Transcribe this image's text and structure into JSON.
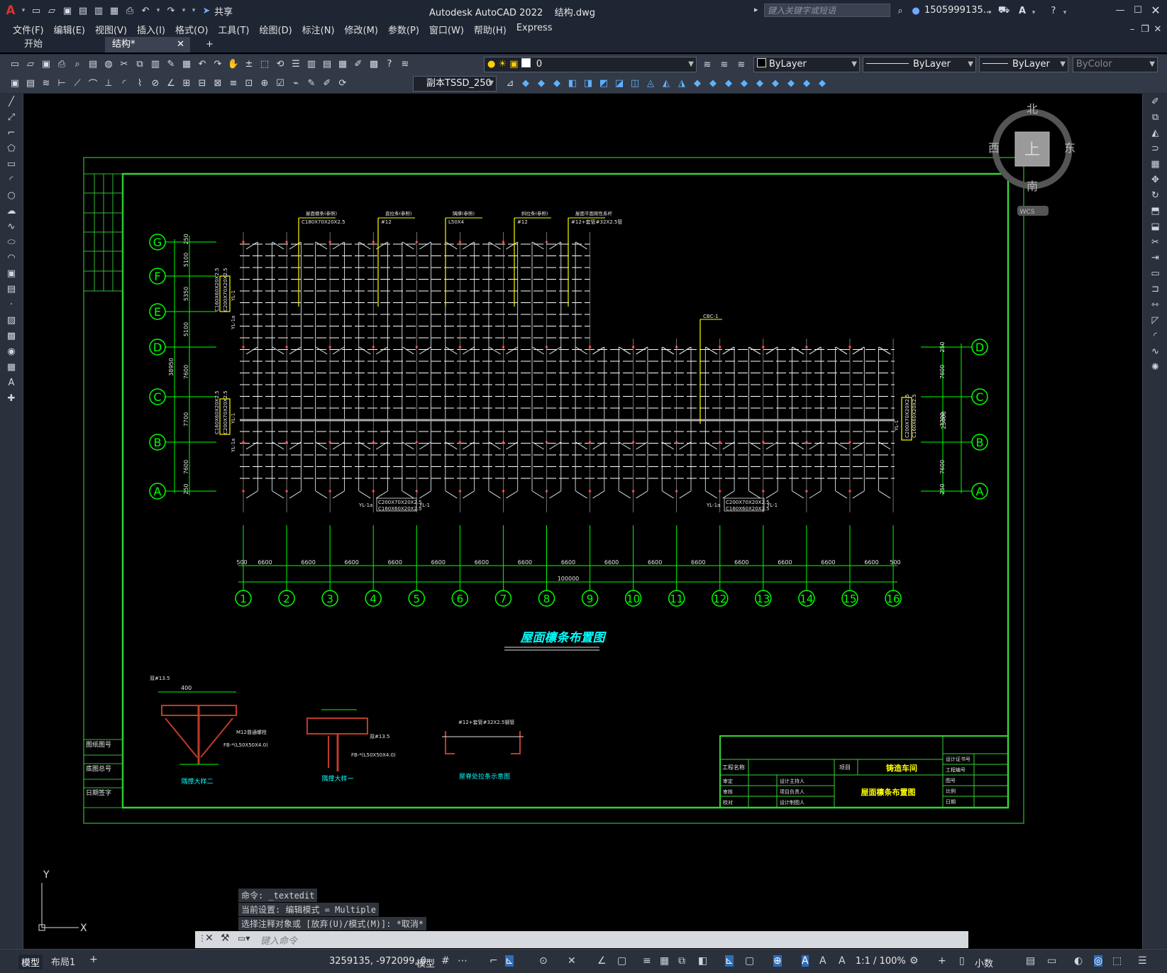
{
  "app": {
    "title": "Autodesk AutoCAD 2022",
    "file": "结构.dwg",
    "search_placeholder": "键入关键字或短语",
    "user": "1505999135...",
    "share": "共享"
  },
  "menu": [
    "文件(F)",
    "编辑(E)",
    "视图(V)",
    "插入(I)",
    "格式(O)",
    "工具(T)",
    "绘图(D)",
    "标注(N)",
    "修改(M)",
    "参数(P)",
    "窗口(W)",
    "帮助(H)",
    "Express"
  ],
  "tabs": {
    "start": "开始",
    "active": "结构*",
    "add": "+"
  },
  "toolbar": {
    "layer_value": "0",
    "color_value": "ByLayer",
    "linetype_value": "ByLayer",
    "lineweight_value": "ByLayer",
    "plotstyle_value": "ByColor",
    "textstyle_value": "副本TSSD_250"
  },
  "viewcube": {
    "north": "北",
    "south": "南",
    "east": "东",
    "west": "西",
    "top": "上",
    "wcs": "WCS"
  },
  "drawing": {
    "title": "屋面檩条布置图",
    "grid_rows": [
      "G",
      "F",
      "E",
      "D",
      "C",
      "B",
      "A"
    ],
    "grid_cols": [
      "1",
      "2",
      "3",
      "4",
      "5",
      "6",
      "7",
      "8",
      "9",
      "10",
      "11",
      "12",
      "13",
      "14",
      "15",
      "16"
    ],
    "bay_label": "6600",
    "edge_label": "500",
    "total_label": "100000",
    "left_dims": [
      "250",
      "5100",
      "5350",
      "5100",
      "7600",
      "7700",
      "7600",
      "250"
    ],
    "left_total": "38950",
    "right_dims": [
      "250",
      "7600",
      "7700",
      "7600",
      "250"
    ],
    "right_total": "23400",
    "top_callouts": [
      {
        "head": "屋面檩条(参照)",
        "sub": "C180X70X20X2.5"
      },
      {
        "head": "直拉条(参照)",
        "sub": "#12"
      },
      {
        "head": "隅撑(参照)",
        "sub": "L50X4"
      },
      {
        "head": "斜拉条(参照)",
        "sub": "#12"
      },
      {
        "head": "屋面平面刚性系杆",
        "sub": "#12+套管#32X2.5管"
      }
    ],
    "cbc_label": "CBC-1",
    "yl": [
      "YL-1",
      "YL-1a"
    ],
    "purlin_left": [
      "C160X60X20X2.5",
      "C200X70X20X2.5"
    ],
    "bottom_purlin": [
      "C200X70X20X2.5",
      "C160X60X20X2.5"
    ],
    "detail_captions": [
      "隅撑大样二",
      "隅撑大样一",
      "屋脊处拉条示意图"
    ],
    "detail_texts": [
      "双#13.5",
      "400",
      "M12普通螺栓",
      "FB-*(L50X50X4.0)",
      "#12+套管#32X2.5钢管"
    ],
    "title_block": {
      "project_label": "工程名称",
      "item_label": "项目",
      "project_name": "铸造车间",
      "drawing_name": "屋面檩条布置图",
      "cols_right": [
        "设计证书号",
        "工程编号",
        "图号",
        "比例",
        "日期"
      ],
      "roles": [
        "审定",
        "审核",
        "校对"
      ],
      "roles2": [
        "设计主持人",
        "项目负责人",
        "设计制图人"
      ]
    },
    "side_table": [
      "图纸图号",
      "底图总号",
      "日期签字"
    ]
  },
  "ucs": {
    "x": "X",
    "y": "Y"
  },
  "command": {
    "history": [
      "命令: _textedit",
      "当前设置: 编辑模式 = Multiple",
      "选择注释对象或 [放弃(U)/模式(M)]: *取消*"
    ],
    "placeholder": "键入命令"
  },
  "layout_tabs": [
    "模型",
    "布局1",
    "+"
  ],
  "status": {
    "coords": "3259135, -972099, 0",
    "space": "模型",
    "scale": "1:1 / 100%",
    "units": "小数"
  },
  "colors": {
    "grid_green": "#00ff00",
    "purlin_white": "#ffffff",
    "accent_yellow": "#ffff00",
    "title_cyan": "#00ffff",
    "brace_red": "#ff2020",
    "bg": "#000000",
    "chrome": "#1f2633"
  }
}
